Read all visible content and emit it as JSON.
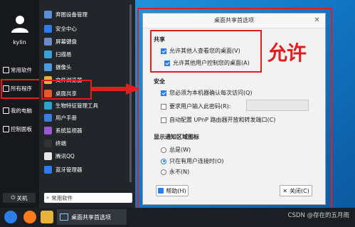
{
  "start_menu": {
    "user": {
      "name": "kylin"
    },
    "left_items": [
      {
        "label": "常用软件"
      },
      {
        "label": "所有程序"
      },
      {
        "label": "我的电脑"
      },
      {
        "label": "控制面板"
      }
    ],
    "power_label": "关机",
    "apps": [
      {
        "label": "奔图设备管理",
        "icon": "printer-icon",
        "color": "#5a8fd6"
      },
      {
        "label": "安全中心",
        "icon": "shield-icon",
        "color": "#2b7de9"
      },
      {
        "label": "屏幕键盘",
        "icon": "keyboard-icon",
        "color": "#6b8cc7"
      },
      {
        "label": "扫描易",
        "icon": "scanner-icon",
        "color": "#3aa0d8"
      },
      {
        "label": "摄像头",
        "icon": "camera-icon",
        "color": "#4b9be0"
      },
      {
        "label": "文件浏览器",
        "icon": "folder-icon",
        "color": "#e7b23a"
      },
      {
        "label": "桌面共享",
        "icon": "desktop-share-icon",
        "color": "#e55a2a"
      },
      {
        "label": "生物特征管理工具",
        "icon": "fingerprint-icon",
        "color": "#2ea0c9"
      },
      {
        "label": "用户手册",
        "icon": "manual-icon",
        "color": "#3b7dd8"
      },
      {
        "label": "系统监视器",
        "icon": "monitor-icon",
        "color": "#9b59d0"
      },
      {
        "label": "终端",
        "icon": "terminal-icon",
        "color": "#333333"
      },
      {
        "label": "腾讯QQ",
        "icon": "qq-icon",
        "color": "#e8e8e8"
      },
      {
        "label": "蓝牙管理器",
        "icon": "bluetooth-icon",
        "color": "#2b7de9"
      }
    ],
    "search_placeholder": "常用软件"
  },
  "dialog": {
    "title": "桌面共享首选项",
    "sharing": {
      "heading": "共享",
      "allow_view": {
        "label": "允许其他人查看您的桌面(V)",
        "checked": true
      },
      "allow_control": {
        "label": "允许其他用户控制您的桌面(A)",
        "checked": true
      }
    },
    "security": {
      "heading": "安全",
      "confirm_each": {
        "label": "您必须为本机器确认每次访问(Q)",
        "checked": true
      },
      "require_password": {
        "label": "要求用户输入此密码(R):",
        "checked": false,
        "value": ""
      },
      "upnp": {
        "label": "自动配置 UPnP 路由器开放和转发端口(C)",
        "checked": false
      }
    },
    "notify": {
      "heading": "显示通知区域图标",
      "options": [
        {
          "label": "总是(W)",
          "selected": false
        },
        {
          "label": "只在有用户连接时(O)",
          "selected": true
        },
        {
          "label": "永不(N)",
          "selected": false
        }
      ]
    },
    "help_label": "帮助(H)",
    "close_label": "关闭(C)"
  },
  "annotation": {
    "text": "允许",
    "color": "#e02020"
  },
  "taskbar": {
    "task_label": "桌面共享首选项",
    "watermark": "CSDN @存在的五月雨"
  },
  "colors": {
    "highlight": "#e02020",
    "accent": "#2b7de9"
  }
}
